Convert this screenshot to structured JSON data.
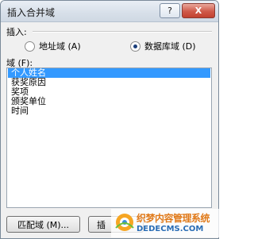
{
  "window": {
    "title": "插入合并域",
    "help_label": "?",
    "close_label": "X"
  },
  "insert_group": {
    "label": "插入:",
    "options": [
      {
        "label": "地址域 (A)",
        "checked": false
      },
      {
        "label": "数据库域 (D)",
        "checked": true
      }
    ]
  },
  "fields": {
    "label": "域 (F):",
    "items": [
      {
        "label": "个人姓名",
        "selected": true
      },
      {
        "label": "获奖原因",
        "selected": false
      },
      {
        "label": "奖项",
        "selected": false
      },
      {
        "label": "颁奖单位",
        "selected": false
      },
      {
        "label": "时间",
        "selected": false
      }
    ]
  },
  "buttons": {
    "match_fields": "匹配域 (M)...",
    "insert": "插"
  },
  "watermark": {
    "line1": "织梦内容管理系统",
    "line2": "DEDECMS.COM",
    "logo_icon": "dedecms-logo-icon"
  }
}
